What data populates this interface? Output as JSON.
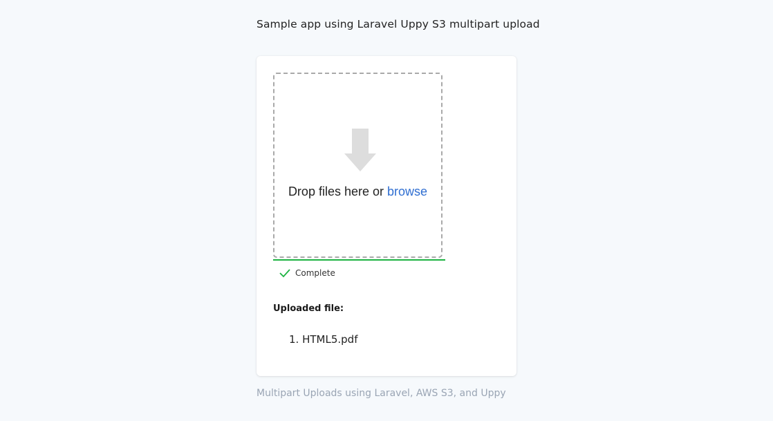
{
  "header": {
    "title": "Sample app using Laravel Uppy S3 multipart upload"
  },
  "uploader": {
    "drop_text": "Drop files here or",
    "browse_label": "browse",
    "drop_icon": "arrow-down-icon",
    "status_text": "Complete",
    "status_icon": "check-icon",
    "progress_percent": 100,
    "colors": {
      "progress": "#1bb240",
      "browse_link": "#2f6ed1",
      "check": "#1bb240"
    }
  },
  "uploaded": {
    "label": "Uploaded file:",
    "files": [
      {
        "number": "1.",
        "name": "HTML5.pdf"
      }
    ]
  },
  "footer": {
    "text": "Multipart Uploads using Laravel, AWS S3, and Uppy"
  }
}
